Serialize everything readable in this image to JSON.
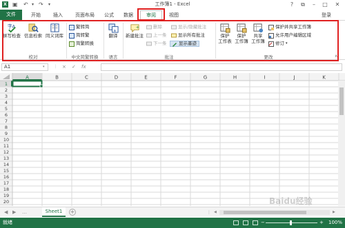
{
  "window": {
    "title": "工作簿1 - Excel",
    "app_icon": "X",
    "help_icon": "?",
    "signin": "登录"
  },
  "tabs": [
    {
      "label": "文件"
    },
    {
      "label": "开始"
    },
    {
      "label": "插入"
    },
    {
      "label": "页面布局"
    },
    {
      "label": "公式"
    },
    {
      "label": "数据"
    },
    {
      "label": "审阅"
    },
    {
      "label": "视图"
    }
  ],
  "ribbon": {
    "proofing": {
      "spell": "拼写检查",
      "research": "信息检索",
      "thesaurus": "同义词库",
      "group": "校对"
    },
    "chinese": {
      "to_simplified": "繁转简",
      "to_traditional": "简转繁",
      "convert": "简繁转换",
      "group": "中文简繁转换"
    },
    "language": {
      "translate": "翻译",
      "group": "语言"
    },
    "comments": {
      "new": "新建批注",
      "delete": "删除",
      "prev": "上一条",
      "next": "下一条",
      "show_hide": "显示/隐藏批注",
      "show_all": "显示所有批注",
      "show_ink": "显示墨迹",
      "group": "批注"
    },
    "changes": {
      "protect_sheet": [
        "保护",
        "工作表"
      ],
      "protect_book": [
        "保护",
        "工作簿"
      ],
      "share_book": [
        "共享",
        "工作簿"
      ],
      "protect_share": "保护并共享工作簿",
      "allow_edit": "允许用户编辑区域",
      "track": "修订",
      "group": "更改"
    }
  },
  "formula_bar": {
    "namebox": "A1",
    "cancel": "×",
    "enter": "✓",
    "fx": "fx"
  },
  "grid": {
    "columns": [
      "A",
      "B",
      "C",
      "D",
      "E",
      "F",
      "G",
      "H",
      "I",
      "J",
      "K"
    ],
    "rows": [
      "1",
      "2",
      "3",
      "4",
      "5",
      "6",
      "7",
      "8",
      "9",
      "10",
      "11",
      "12",
      "13",
      "14",
      "15",
      "16",
      "17",
      "18",
      "19",
      "20"
    ]
  },
  "sheets": {
    "active": "Sheet1",
    "add": "+"
  },
  "status": {
    "text": "就绪",
    "zoom": "100%"
  },
  "watermark": "Baidu经验",
  "colors": {
    "excel_green": "#217346",
    "highlight_red": "#e02020"
  }
}
